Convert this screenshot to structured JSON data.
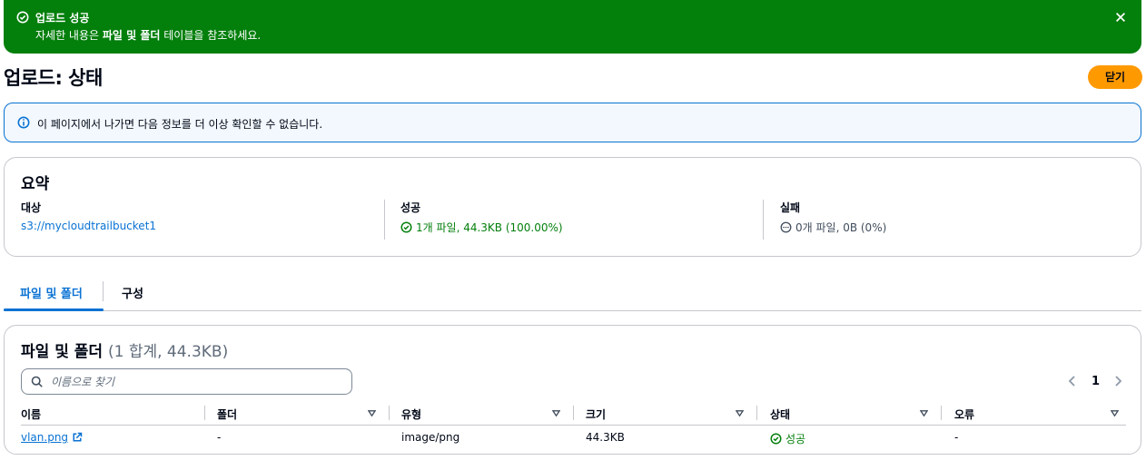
{
  "flash": {
    "title": "업로드 성공",
    "message_prefix": "자세한 내용은 ",
    "message_bold": "파일 및 폴더",
    "message_suffix": " 테이블을 참조하세요."
  },
  "header": {
    "title": "업로드: 상태",
    "close_label": "닫기"
  },
  "info": {
    "text": "이 페이지에서 나가면 다음 정보를 더 이상 확인할 수 없습니다."
  },
  "summary": {
    "title": "요약",
    "destination_label": "대상",
    "destination_value": "s3://mycloudtrailbucket1",
    "success_label": "성공",
    "success_value": "1개 파일, 44.3KB (100.00%)",
    "failed_label": "실패",
    "failed_value": "0개 파일, 0B (0%)"
  },
  "tabs": [
    {
      "label": "파일 및 폴더"
    },
    {
      "label": "구성"
    }
  ],
  "files": {
    "title": "파일 및 폴더",
    "count": "(1 합계, 44.3KB)",
    "search_placeholder": "이름으로 찾기",
    "page": "1",
    "columns": [
      "이름",
      "폴더",
      "유형",
      "크기",
      "상태",
      "오류"
    ],
    "rows": [
      {
        "name": "vlan.png",
        "folder": "-",
        "type": "image/png",
        "size": "44.3KB",
        "status": "성공",
        "error": "-"
      }
    ]
  },
  "colors": {
    "success": "#037f0c",
    "link": "#0972d3",
    "accent": "#ff9900"
  }
}
